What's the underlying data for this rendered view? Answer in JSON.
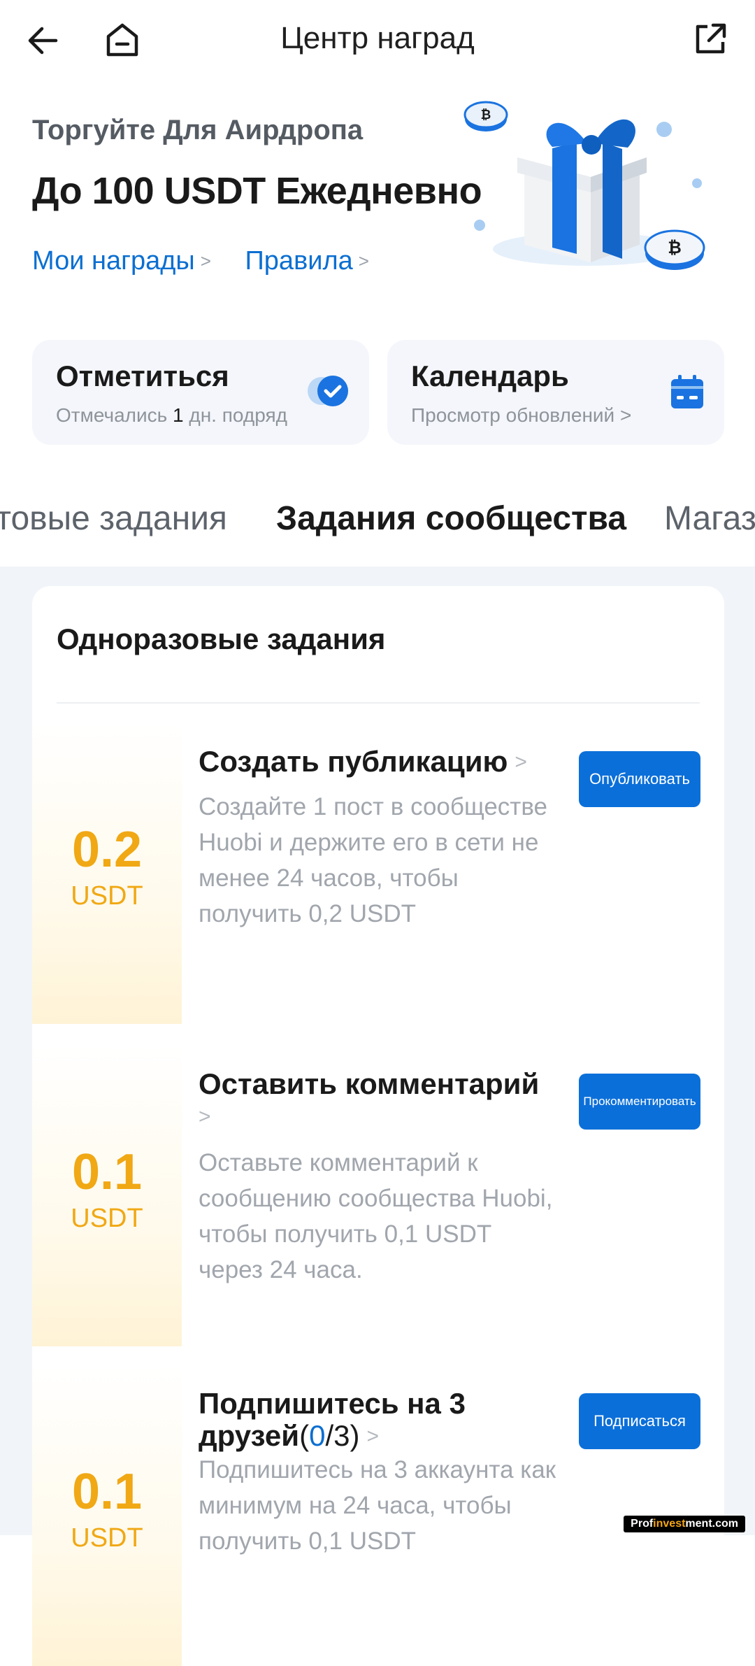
{
  "header": {
    "title": "Центр наград"
  },
  "hero": {
    "subtitle": "Торгуйте Для Аирдропа",
    "title": "До 100 USDT Ежедневно",
    "links": [
      {
        "label": "Мои награды"
      },
      {
        "label": "Правила"
      }
    ]
  },
  "cards": {
    "checkin": {
      "title": "Отметиться",
      "sub_pre": "Отмечались",
      "count": "1",
      "sub_post": "дн. подряд"
    },
    "calendar": {
      "title": "Календарь",
      "sub": "Просмотр обновлений >"
    }
  },
  "tabs": [
    {
      "label": "Торговые задания",
      "visible_text": "товые задания"
    },
    {
      "label": "Задания сообщества",
      "active": true
    },
    {
      "label": "Магазин",
      "visible_text": "Магаз"
    }
  ],
  "section": {
    "title": "Одноразовые задания"
  },
  "tasks": [
    {
      "reward_value": "0.2",
      "reward_currency": "USDT",
      "title": "Создать публикацию",
      "description": "Создайте 1 пост в сообществе Huobi и держите его в сети не менее 24 часов, чтобы получить 0,2 USDT",
      "button": "Опубликовать"
    },
    {
      "reward_value": "0.1",
      "reward_currency": "USDT",
      "title": "Оставить комментарий",
      "description": "Оставьте комментарий к сообщению сообщества Huobi, чтобы получить 0,1 USDT через 24 часа.",
      "button": "Прокомментировать"
    },
    {
      "reward_value": "0.1",
      "reward_currency": "USDT",
      "title": "Подпишитесь на 3 друзей",
      "progress_open": "(",
      "progress_done": "0",
      "progress_total": "/3)",
      "description": "Подпишитесь на 3 аккаунта как минимум на 24 часа, чтобы получить 0,1 USDT",
      "button": "Подписаться"
    }
  ],
  "watermark": {
    "prefix": "Prof",
    "accent": "invest",
    "suffix": "ment.com"
  },
  "colors": {
    "accent": "#0b6fd9",
    "reward": "#f0a814",
    "panel_bg": "#f1f4f8"
  }
}
